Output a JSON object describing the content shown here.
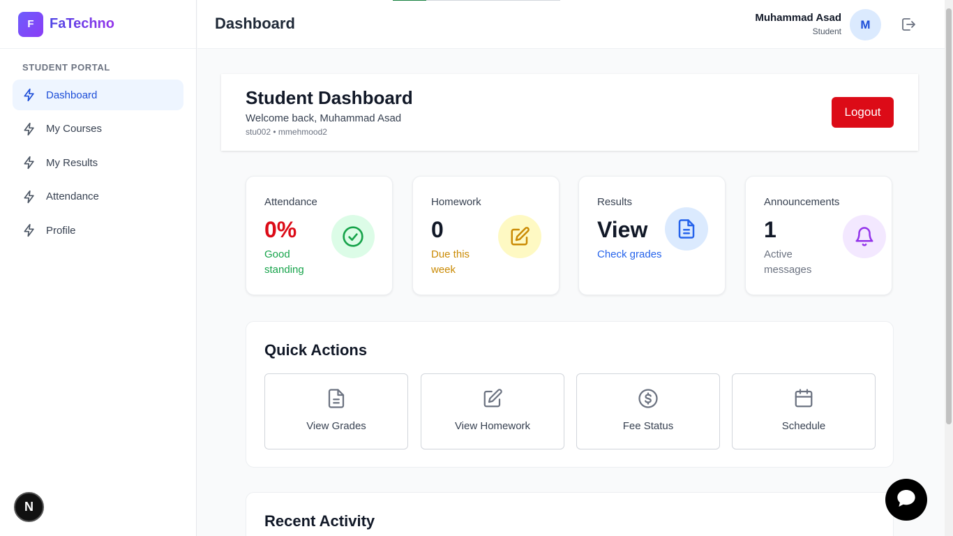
{
  "brand": {
    "logo_letter": "F",
    "name": "FaTechno"
  },
  "sidebar": {
    "section_label": "STUDENT PORTAL",
    "items": [
      {
        "label": "Dashboard",
        "icon": "bolt-icon",
        "active": true
      },
      {
        "label": "My Courses",
        "icon": "bolt-icon"
      },
      {
        "label": "My Results",
        "icon": "bolt-icon"
      },
      {
        "label": "Attendance",
        "icon": "bolt-icon"
      },
      {
        "label": "Profile",
        "icon": "bolt-icon"
      }
    ],
    "dev_badge": "N"
  },
  "header": {
    "title": "Dashboard",
    "user_name": "Muhammad Asad",
    "user_role": "Student",
    "avatar_letter": "M",
    "loading_progress": 0.2
  },
  "welcome": {
    "title": "Student Dashboard",
    "greeting": "Welcome back, Muhammad Asad",
    "ids": "stu002 • mmehmood2",
    "logout_label": "Logout"
  },
  "stats": [
    {
      "label": "Attendance",
      "value": "0%",
      "sub": "Good standing",
      "value_color": "#dc0b17",
      "sub_color": "#16a34a",
      "icon": "check-circle-icon",
      "icon_bg": "#dcfce7",
      "icon_color": "#16a34a"
    },
    {
      "label": "Homework",
      "value": "0",
      "sub": "Due this week",
      "value_color": "#111827",
      "sub_color": "#ca8a04",
      "icon": "edit-icon",
      "icon_bg": "#fef9c3",
      "icon_color": "#ca8a04"
    },
    {
      "label": "Results",
      "value": "View",
      "sub": "Check grades",
      "value_color": "#111827",
      "sub_color": "#2563eb",
      "icon": "document-icon",
      "icon_bg": "#dbeafe",
      "icon_color": "#2563eb"
    },
    {
      "label": "Announcements",
      "value": "1",
      "sub": "Active messages",
      "value_color": "#111827",
      "sub_color": "#6b7280",
      "icon": "bell-icon",
      "icon_bg": "#f3e8ff",
      "icon_color": "#9333ea"
    }
  ],
  "quick_actions": {
    "title": "Quick Actions",
    "items": [
      {
        "label": "View Grades",
        "icon": "document-icon"
      },
      {
        "label": "View Homework",
        "icon": "edit-icon"
      },
      {
        "label": "Fee Status",
        "icon": "dollar-circle-icon"
      },
      {
        "label": "Schedule",
        "icon": "calendar-icon"
      }
    ]
  },
  "recent_activity": {
    "title": "Recent Activity"
  }
}
